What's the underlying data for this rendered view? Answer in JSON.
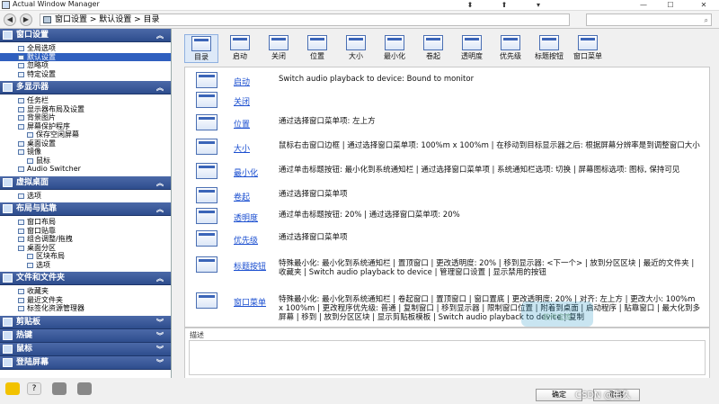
{
  "window": {
    "title": "Actual Window Manager"
  },
  "titlebar": {
    "buttons": [
      "⬍",
      "⬆",
      "▾",
      "—",
      "☐",
      "✕"
    ]
  },
  "address": {
    "path": "窗口设置 > 默认设置 > 目录"
  },
  "sidebar": {
    "categories": [
      {
        "label": "窗口设置",
        "chevron": "︽",
        "items": [
          {
            "label": "全局选项",
            "level": 1,
            "selected": false
          },
          {
            "label": "默认设置",
            "level": 1,
            "selected": true
          },
          {
            "label": "忽略项",
            "level": 1,
            "selected": false
          },
          {
            "label": "特定设置",
            "level": 1,
            "selected": false
          }
        ]
      },
      {
        "label": "多显示器",
        "chevron": "︽",
        "items": [
          {
            "label": "任务栏",
            "level": 1,
            "selected": false
          },
          {
            "label": "显示器布局及设置",
            "level": 1,
            "selected": false
          },
          {
            "label": "背景图片",
            "level": 1,
            "selected": false
          },
          {
            "label": "屏幕保护程序",
            "level": 1,
            "selected": false
          },
          {
            "label": "保存空闲屏幕",
            "level": 2,
            "selected": false
          },
          {
            "label": "桌面设置",
            "level": 1,
            "selected": false
          },
          {
            "label": "镜像",
            "level": 1,
            "selected": false
          },
          {
            "label": "鼠标",
            "level": 2,
            "selected": false
          },
          {
            "label": "Audio Switcher",
            "level": 1,
            "selected": false
          }
        ]
      },
      {
        "label": "虚拟桌面",
        "chevron": "︽",
        "items": [
          {
            "label": "选项",
            "level": 1,
            "selected": false
          }
        ]
      },
      {
        "label": "布局与贴靠",
        "chevron": "︽",
        "items": [
          {
            "label": "窗口布局",
            "level": 1,
            "selected": false
          },
          {
            "label": "窗口贴靠",
            "level": 1,
            "selected": false
          },
          {
            "label": "组合调整/拖拽",
            "level": 1,
            "selected": false
          },
          {
            "label": "桌面分区",
            "level": 1,
            "selected": false
          },
          {
            "label": "区块布局",
            "level": 2,
            "selected": false
          },
          {
            "label": "选项",
            "level": 2,
            "selected": false
          }
        ]
      },
      {
        "label": "文件和文件夹",
        "chevron": "︽",
        "items": [
          {
            "label": "收藏夹",
            "level": 1,
            "selected": false
          },
          {
            "label": "最近文件夹",
            "level": 1,
            "selected": false
          },
          {
            "label": "标签化资源管理器",
            "level": 1,
            "selected": false
          }
        ]
      },
      {
        "label": "剪贴板",
        "chevron": "︾",
        "items": []
      },
      {
        "label": "热键",
        "chevron": "︾",
        "items": []
      },
      {
        "label": "鼠标",
        "chevron": "︾",
        "items": []
      },
      {
        "label": "登陆屏幕",
        "chevron": "︾",
        "items": []
      }
    ]
  },
  "toolbar": {
    "tools": [
      "目录",
      "启动",
      "关闭",
      "位置",
      "大小",
      "最小化",
      "卷起",
      "透明度",
      "优先级",
      "标题按钮",
      "窗口菜单"
    ],
    "active_index": 0
  },
  "content": {
    "rows": [
      {
        "label": "启动",
        "desc": "Switch audio playback to device: Bound to monitor"
      },
      {
        "label": "关闭",
        "desc": ""
      },
      {
        "label": "位置",
        "desc": "通过选择窗口菜单项: 左上方"
      },
      {
        "label": "大小",
        "desc": "鼠标右击窗口边框 | 通过选择窗口菜单项: 100%m x 100%m | 在移动到目标显示器之后: 根据屏幕分辨率是到调整窗口大小"
      },
      {
        "label": "最小化",
        "desc": "通过单击标题按钮: 最小化到系统通知栏 | 通过选择窗口菜单项 | 系统通知栏选项: 切换 | 屏幕图标选项: 图标, 保持可见"
      },
      {
        "label": "卷起",
        "desc": "通过选择窗口菜单项"
      },
      {
        "label": "透明度",
        "desc": "通过单击标题按钮: 20% | 通过选择窗口菜单项: 20%"
      },
      {
        "label": "优先级",
        "desc": "通过选择窗口菜单项"
      },
      {
        "label": "标题按钮",
        "desc": "特殊最小化: 最小化到系统通知栏 | 置顶窗口 | 更改透明度: 20% | 移到显示器: <下一个> | 放到分区区块 | 最近的文件夹 | 收藏夹 | Switch audio playback to device | 管理窗口设置 | 显示禁用的按钮"
      },
      {
        "label": "窗口菜单",
        "desc": "特殊最小化: 最小化到系统通知栏 | 卷起窗口 | 置顶窗口 | 窗口置底 | 更改透明度: 20% | 对齐: 左上方 | 更改大小: 100%m x 100%m | 更改程序优先级: 普通 | 复制窗口 | 移到显示器 | 限制窗口位置 | 附着到桌面 | 启动程序 | 贴靠窗口 | 最大化到多屏幕 | 移到 | 放到分区区块 | 显示剪贴板模板 | Switch audio playback to device | 复制"
      }
    ]
  },
  "description": {
    "label": "描述"
  },
  "watermark": {
    "line1": "软件宝库"
  },
  "buttons": {
    "ok": "确定",
    "cancel": "取消"
  },
  "csdn": {
    "text": "CSDN @由久"
  }
}
